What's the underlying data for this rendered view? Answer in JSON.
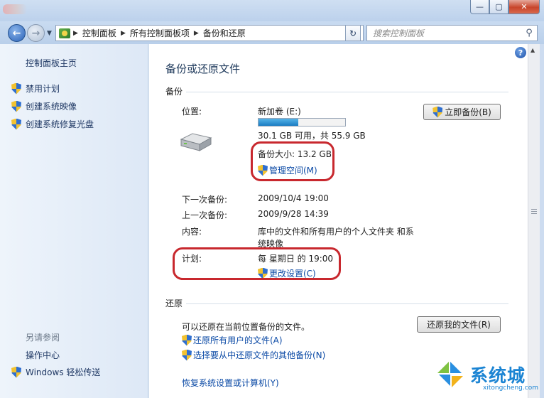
{
  "window": {
    "minimize_icon": "minimize-icon",
    "maximize_icon": "maximize-icon",
    "close_icon": "close-icon"
  },
  "address": {
    "breadcrumbs": [
      "控制面板",
      "所有控制面板项",
      "备份和还原"
    ],
    "search_placeholder": "搜索控制面板"
  },
  "sidebar": {
    "home": "控制面板主页",
    "items": [
      {
        "label": "禁用计划",
        "icon": "shield-icon"
      },
      {
        "label": "创建系统映像",
        "icon": "shield-icon"
      },
      {
        "label": "创建系统修复光盘",
        "icon": "shield-icon"
      }
    ],
    "see_also_heading": "另请参阅",
    "see_also": [
      {
        "label": "操作中心"
      },
      {
        "label": "Windows 轻松传送",
        "icon": "shield-icon"
      }
    ]
  },
  "main": {
    "title": "备份或还原文件",
    "backup": {
      "heading": "备份",
      "location_label": "位置:",
      "location_value": "新加卷 (E:)",
      "disk_used_fraction": 0.46,
      "free_space": "30.1 GB 可用，共 55.9 GB",
      "backup_size": "备份大小: 13.2 GB",
      "manage_space_link": "管理空间(M)",
      "backup_now_button": "立即备份(B)",
      "next_backup_label": "下一次备份:",
      "next_backup_value": "2009/10/4 19:00",
      "last_backup_label": "上一次备份:",
      "last_backup_value": "2009/9/28 14:39",
      "contents_label": "内容:",
      "contents_value_line1": "库中的文件和所有用户的个人文件夹 和系",
      "contents_value_line2": "统映像",
      "schedule_label": "计划:",
      "schedule_value": "每 星期日 的 19:00",
      "change_settings_link": "更改设置(C)"
    },
    "restore": {
      "heading": "还原",
      "description": "可以还原在当前位置备份的文件。",
      "restore_my_files_button": "还原我的文件(R)",
      "restore_all_users_link": "还原所有用户的文件(A)",
      "select_other_backup_link": "选择要从中还原文件的其他备份(N)",
      "recover_system_link": "恢复系统设置或计算机(Y)"
    }
  },
  "watermark": {
    "brand": "系统城",
    "domain": "xitongcheng.com"
  },
  "colors": {
    "link": "#0a49a5",
    "highlight_outline": "#c8282e",
    "watermark": "#1b84d3"
  }
}
